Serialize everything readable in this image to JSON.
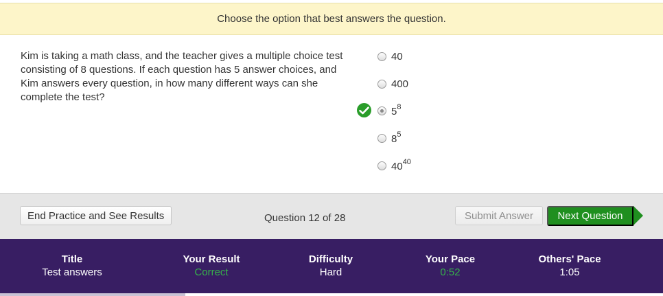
{
  "instruction": "Choose the option that best answers the question.",
  "question": "Kim is taking a math class, and the teacher gives a multiple choice test consisting of 8 questions. If each question has 5 answer choices, and Kim answers every question, in how many different ways can she complete the test?",
  "options": [
    {
      "base": "40",
      "exp": "",
      "selected": false
    },
    {
      "base": "400",
      "exp": "",
      "selected": false
    },
    {
      "base": "5",
      "exp": "8",
      "selected": true
    },
    {
      "base": "8",
      "exp": "5",
      "selected": false
    },
    {
      "base": "40",
      "exp": "40",
      "selected": false
    }
  ],
  "correct_icon": "check-icon",
  "footer": {
    "end_label": "End Practice and See Results",
    "counter": "Question 12 of 28",
    "submit_label": "Submit Answer",
    "next_label": "Next Question"
  },
  "stats": {
    "title_head": "Title",
    "title_val": "Test answers",
    "result_head": "Your Result",
    "result_val": "Correct",
    "difficulty_head": "Difficulty",
    "difficulty_val": "Hard",
    "pace_head": "Your Pace",
    "pace_val": "0:52",
    "others_head": "Others' Pace",
    "others_val": "1:05"
  },
  "progress_fraction": 0.28,
  "colors": {
    "accent_green": "#1f8f1f",
    "stats_bg": "#381e63",
    "instruction_bg": "#fdf5c9"
  }
}
